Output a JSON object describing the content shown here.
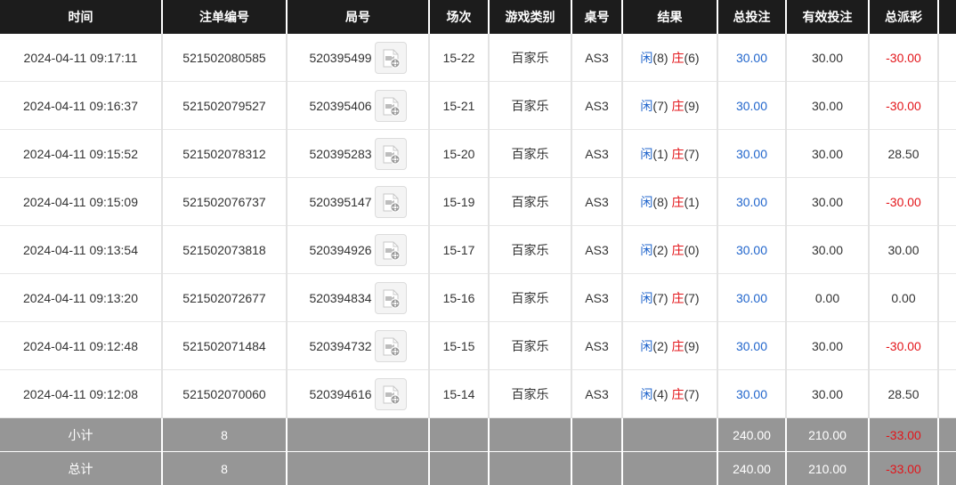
{
  "colors": {
    "header_bg": "#1c1c1c",
    "footer_bg": "#969696",
    "blue": "#2266cc",
    "red": "#e3151a"
  },
  "headers": [
    "时间",
    "注单编号",
    "局号",
    "场次",
    "游戏类别",
    "桌号",
    "结果",
    "总投注",
    "有效投注",
    "总派彩",
    ""
  ],
  "rows": [
    {
      "time": "2024-04-11 09:17:11",
      "bet_id": "521502080585",
      "round": "520395499",
      "shoe": "15-22",
      "game": "百家乐",
      "table": "AS3",
      "player_label": "闲",
      "player_val": "(8)",
      "banker_label": "庄",
      "banker_val": "(6)",
      "total_bet": "30.00",
      "valid_bet": "30.00",
      "payout": "-30.00",
      "payout_color": "red"
    },
    {
      "time": "2024-04-11 09:16:37",
      "bet_id": "521502079527",
      "round": "520395406",
      "shoe": "15-21",
      "game": "百家乐",
      "table": "AS3",
      "player_label": "闲",
      "player_val": "(7)",
      "banker_label": "庄",
      "banker_val": "(9)",
      "total_bet": "30.00",
      "valid_bet": "30.00",
      "payout": "-30.00",
      "payout_color": "red"
    },
    {
      "time": "2024-04-11 09:15:52",
      "bet_id": "521502078312",
      "round": "520395283",
      "shoe": "15-20",
      "game": "百家乐",
      "table": "AS3",
      "player_label": "闲",
      "player_val": "(1)",
      "banker_label": "庄",
      "banker_val": "(7)",
      "total_bet": "30.00",
      "valid_bet": "30.00",
      "payout": "28.50",
      "payout_color": "dark"
    },
    {
      "time": "2024-04-11 09:15:09",
      "bet_id": "521502076737",
      "round": "520395147",
      "shoe": "15-19",
      "game": "百家乐",
      "table": "AS3",
      "player_label": "闲",
      "player_val": "(8)",
      "banker_label": "庄",
      "banker_val": "(1)",
      "total_bet": "30.00",
      "valid_bet": "30.00",
      "payout": "-30.00",
      "payout_color": "red"
    },
    {
      "time": "2024-04-11 09:13:54",
      "bet_id": "521502073818",
      "round": "520394926",
      "shoe": "15-17",
      "game": "百家乐",
      "table": "AS3",
      "player_label": "闲",
      "player_val": "(2)",
      "banker_label": "庄",
      "banker_val": "(0)",
      "total_bet": "30.00",
      "valid_bet": "30.00",
      "payout": "30.00",
      "payout_color": "dark"
    },
    {
      "time": "2024-04-11 09:13:20",
      "bet_id": "521502072677",
      "round": "520394834",
      "shoe": "15-16",
      "game": "百家乐",
      "table": "AS3",
      "player_label": "闲",
      "player_val": "(7)",
      "banker_label": "庄",
      "banker_val": "(7)",
      "total_bet": "30.00",
      "valid_bet": "0.00",
      "payout": "0.00",
      "payout_color": "dark"
    },
    {
      "time": "2024-04-11 09:12:48",
      "bet_id": "521502071484",
      "round": "520394732",
      "shoe": "15-15",
      "game": "百家乐",
      "table": "AS3",
      "player_label": "闲",
      "player_val": "(2)",
      "banker_label": "庄",
      "banker_val": "(9)",
      "total_bet": "30.00",
      "valid_bet": "30.00",
      "payout": "-30.00",
      "payout_color": "red"
    },
    {
      "time": "2024-04-11 09:12:08",
      "bet_id": "521502070060",
      "round": "520394616",
      "shoe": "15-14",
      "game": "百家乐",
      "table": "AS3",
      "player_label": "闲",
      "player_val": "(4)",
      "banker_label": "庄",
      "banker_val": "(7)",
      "total_bet": "30.00",
      "valid_bet": "30.00",
      "payout": "28.50",
      "payout_color": "dark"
    }
  ],
  "subtotal": {
    "label": "小计",
    "count": "8",
    "total_bet": "240.00",
    "valid_bet": "210.00",
    "payout": "-33.00"
  },
  "grand_total": {
    "label": "总计",
    "count": "8",
    "total_bet": "240.00",
    "valid_bet": "210.00",
    "payout": "-33.00"
  },
  "icons": {
    "replay": "video-replay-icon"
  }
}
